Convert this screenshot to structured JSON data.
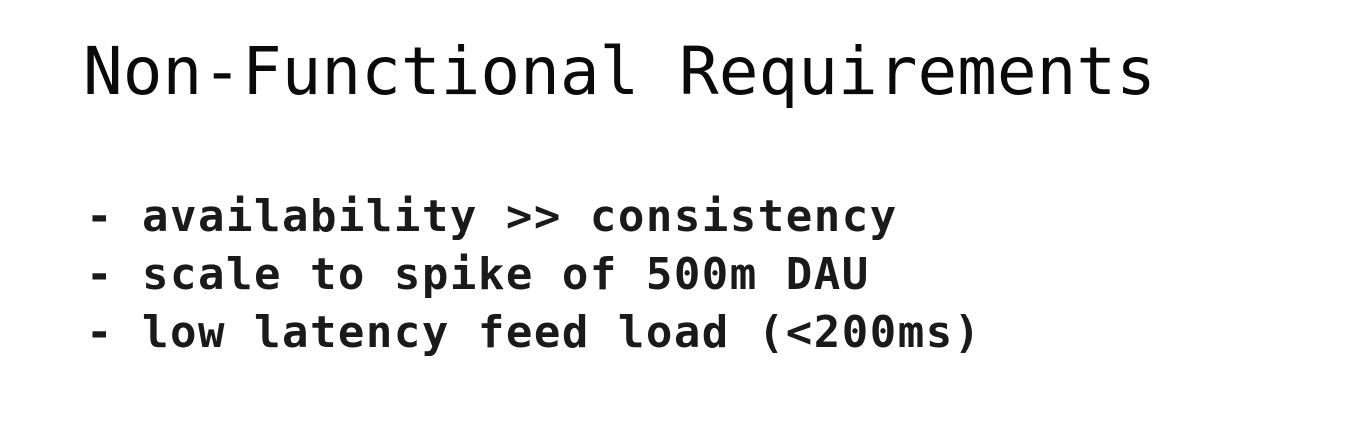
{
  "slide": {
    "title": "Non-Functional Requirements",
    "items": [
      {
        "bullet": "-",
        "text": "availability >> consistency"
      },
      {
        "bullet": "-",
        "text": "scale to spike of 500m DAU"
      },
      {
        "bullet": "-",
        "text": "low latency feed load (<200ms)"
      }
    ]
  },
  "colors": {
    "background": "#ffffff",
    "text": "#0a0a0a"
  }
}
